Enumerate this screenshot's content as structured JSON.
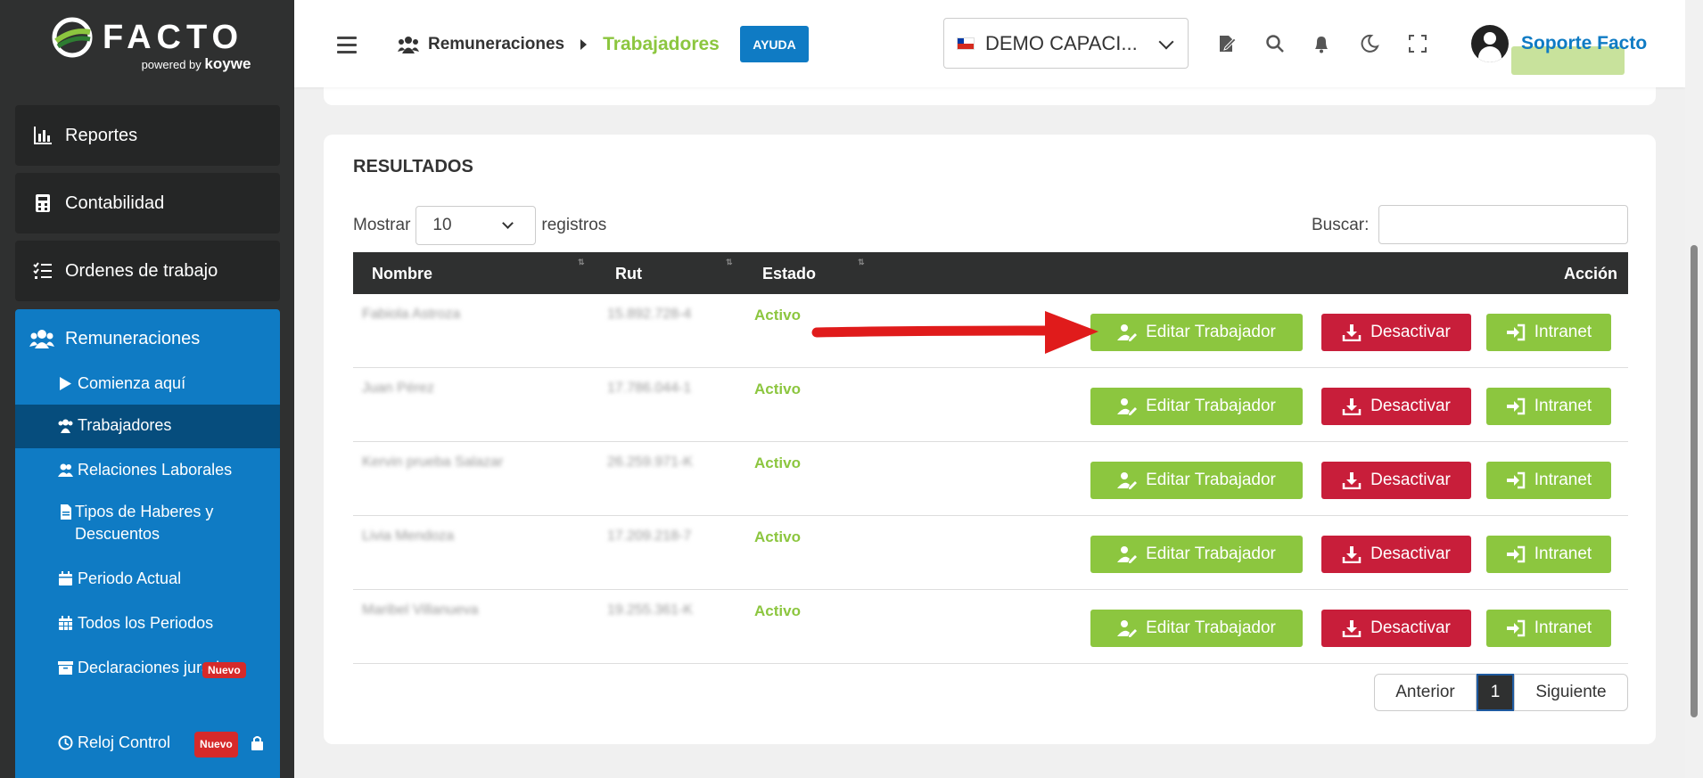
{
  "brand": {
    "name": "FACTO",
    "powered_by": "powered by",
    "partner": "koywe"
  },
  "sidebar": {
    "items": [
      {
        "label": "Reportes",
        "icon": "chart-bar-icon"
      },
      {
        "label": "Contabilidad",
        "icon": "calculator-icon"
      },
      {
        "label": "Ordenes de trabajo",
        "icon": "tasks-icon"
      }
    ],
    "remuneraciones": {
      "label": "Remuneraciones",
      "subitems": [
        {
          "label": "Comienza aquí",
          "icon": "play-icon"
        },
        {
          "label": "Trabajadores",
          "icon": "users-icon",
          "active": true
        },
        {
          "label": "Relaciones Laborales",
          "icon": "user-group-icon"
        },
        {
          "label": "Tipos de Haberes y Descuentos",
          "icon": "file-icon"
        },
        {
          "label": "Periodo Actual",
          "icon": "calendar-icon"
        },
        {
          "label": "Todos los Periodos",
          "icon": "calendar-grid-icon"
        },
        {
          "label": "Declaraciones juradas",
          "icon": "archive-icon",
          "badge": "Nuevo"
        },
        {
          "label": "Reloj Control",
          "icon": "clock-icon",
          "badge": "Nuevo"
        }
      ]
    }
  },
  "header": {
    "breadcrumb": {
      "section": "Remuneraciones",
      "current": "Trabajadores"
    },
    "help_label": "AYUDA",
    "company": "DEMO CAPACI...",
    "user_name": "Soporte Facto"
  },
  "results": {
    "title": "RESULTADOS",
    "show_label": "Mostrar",
    "page_size": "10",
    "records_label": "registros",
    "search_label": "Buscar:",
    "search_value": "",
    "columns": {
      "nombre": "Nombre",
      "rut": "Rut",
      "estado": "Estado",
      "accion": "Acción"
    },
    "rows": [
      {
        "nombre": "Fabiola Astroza",
        "rut": "15.892.728-4",
        "estado": "Activo"
      },
      {
        "nombre": "Juan Pérez",
        "rut": "17.786.044-1",
        "estado": "Activo"
      },
      {
        "nombre": "Kervin prueba Salazar",
        "rut": "26.259.971-K",
        "estado": "Activo"
      },
      {
        "nombre": "Livia Mendoza",
        "rut": "17.209.218-7",
        "estado": "Activo"
      },
      {
        "nombre": "Maribel Villanueva",
        "rut": "19.255.361-K",
        "estado": "Activo"
      }
    ],
    "actions": {
      "edit": "Editar Trabajador",
      "deactivate": "Desactivar",
      "intranet": "Intranet"
    },
    "pagination": {
      "prev": "Anterior",
      "current": "1",
      "next": "Siguiente"
    }
  },
  "colors": {
    "sidebar_bg": "#2f3030",
    "primary_blue": "#0f7bc4",
    "green": "#8cc63f",
    "red": "#c81e3a",
    "arrow": "#e01b1b"
  }
}
